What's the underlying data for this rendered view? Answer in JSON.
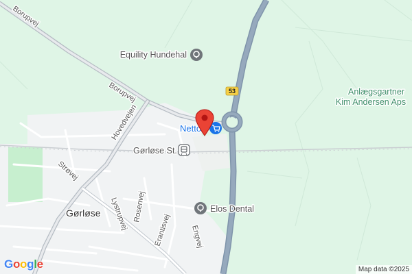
{
  "map": {
    "roads": {
      "borupvej_top": "Borupvej",
      "borupvej_mid": "Borupvej",
      "hovedvejen": "Hovedvejen",
      "strovej": "Strøvej",
      "lystrupvej": "Lystrupvej",
      "rosenvej": "Rosenvej",
      "erantisvej": "Erantisvej",
      "engvej": "Engvej"
    },
    "route_shield": "53",
    "places": {
      "hundehal": "Equility Hundehal",
      "anlaeg_line1": "Anlægsgartner",
      "anlaeg_line2": "Kim Andersen Aps",
      "netto": "Netto",
      "station": "Gørløse St.",
      "elos": "Elos Dental",
      "town": "Gørløse"
    },
    "colors": {
      "green_area": "#dff5e6",
      "town_area": "#f1f3f4",
      "park": "#c7efcf",
      "highway": "#8fa3b8",
      "road": "#ffffff",
      "pin": "#ea4335",
      "netto_blue": "#1a73e8"
    }
  },
  "footer": {
    "logo_letters": [
      "G",
      "o",
      "o",
      "g",
      "l",
      "e"
    ],
    "attribution": "Map data ©2025"
  }
}
